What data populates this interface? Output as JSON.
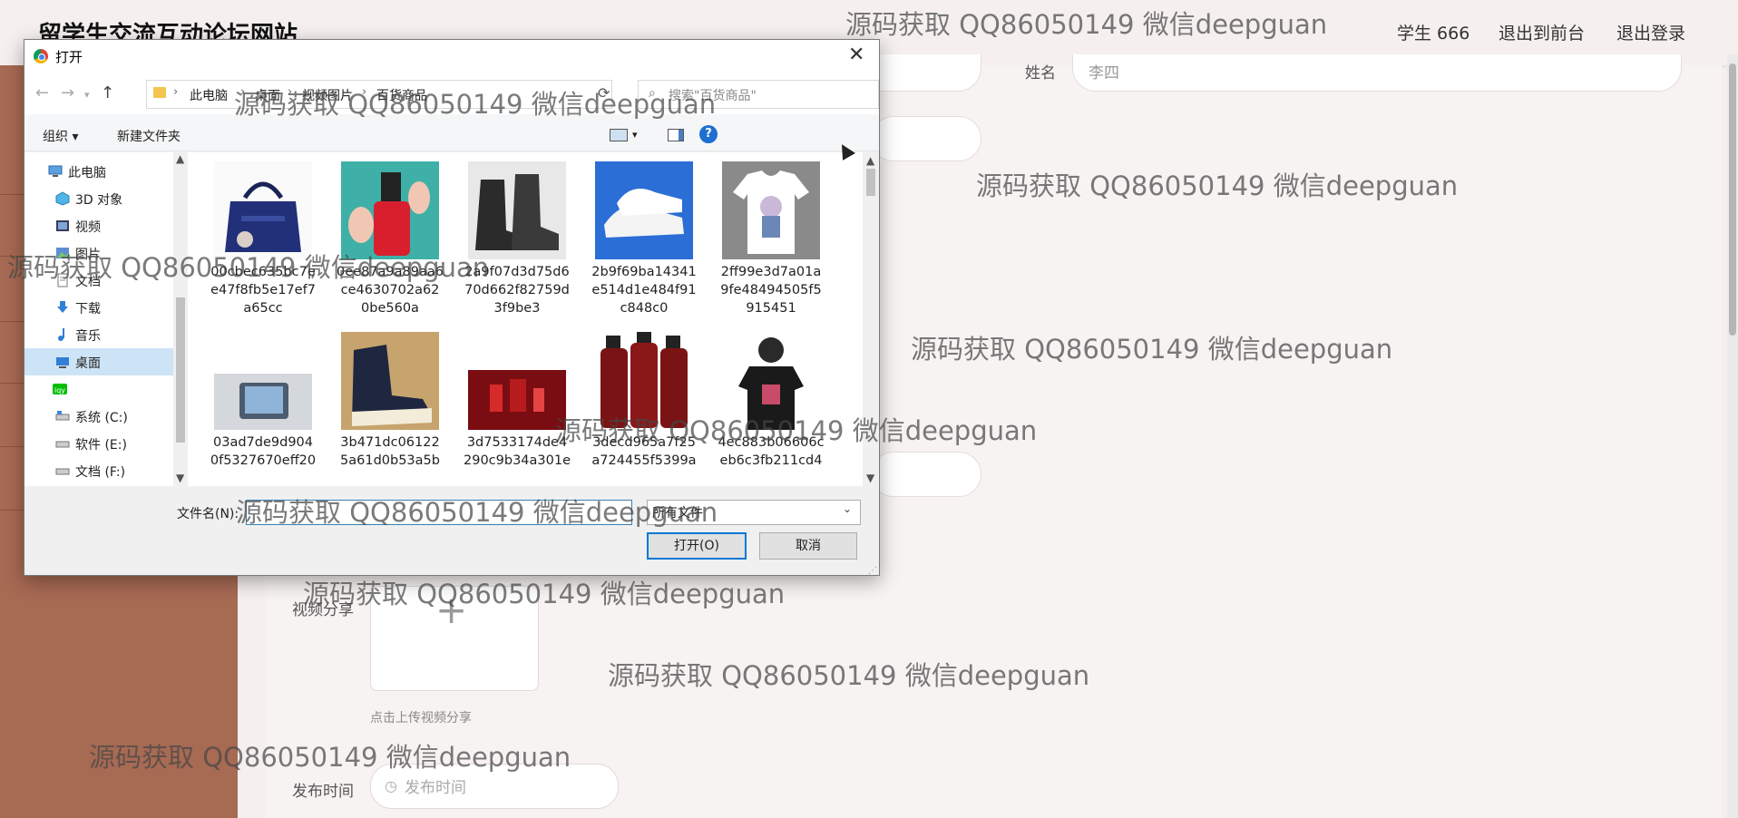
{
  "app": {
    "site_title": "留学生交流互动论坛网站",
    "nav": {
      "user": "学生 666",
      "back_to_front": "退出到前台",
      "logout": "退出登录"
    },
    "form": {
      "name_label": "姓名",
      "name_value": "李四",
      "video_label": "视频分享",
      "upload_plus": "+",
      "upload_hint": "点击上传视频分享",
      "time_label": "发布时间",
      "time_placeholder": "发布时间"
    }
  },
  "dialog": {
    "title": "打开",
    "close": "✕",
    "address": [
      "此电脑",
      "桌面",
      "视频图片",
      "百货商品"
    ],
    "search_placeholder": "搜索\"百货商品\"",
    "toolbar": {
      "organize": "组织 ▾",
      "new_folder": "新建文件夹",
      "help": "?"
    },
    "tree": [
      {
        "label": "此电脑",
        "icon": "computer-icon"
      },
      {
        "label": "3D 对象",
        "icon": "3d-objects-icon"
      },
      {
        "label": "视频",
        "icon": "video-icon"
      },
      {
        "label": "图片",
        "icon": "picture-icon"
      },
      {
        "label": "文档",
        "icon": "document-icon"
      },
      {
        "label": "下载",
        "icon": "download-icon"
      },
      {
        "label": "音乐",
        "icon": "music-icon"
      },
      {
        "label": "桌面",
        "icon": "desktop-icon",
        "selected": true
      },
      {
        "label": "",
        "icon": "iqiyi-icon"
      },
      {
        "label": "系统 (C:)",
        "icon": "drive-icon"
      },
      {
        "label": "软件 (E:)",
        "icon": "drive-icon"
      },
      {
        "label": "文档 (F:)",
        "icon": "drive-icon"
      }
    ],
    "files": [
      {
        "name": "00cbec635bc7ee47f8fb5e17ef7a65cc",
        "icon": "handbag-thumbnail"
      },
      {
        "name": "0ee87a9a89aa6ce4630702a620be560a",
        "icon": "nail-polish-thumbnail"
      },
      {
        "name": "2a9f07d3d75d670d662f82759d3f9be3",
        "icon": "boots-thumbnail"
      },
      {
        "name": "2b9f69ba14341e514d1e484f91c848c0",
        "icon": "sneakers-thumbnail"
      },
      {
        "name": "2ff99e3d7a01a9fe48494505f5915451",
        "icon": "tshirt-thumbnail"
      },
      {
        "name": "03ad7de9d9040f5327670eff20",
        "icon": "phone-thumbnail"
      },
      {
        "name": "3b471dc061225a61d0b53a5b",
        "icon": "high-top-shoes-thumbnail"
      },
      {
        "name": "3d7533174de4290c9b34a301e",
        "icon": "cosmetics-thumbnail"
      },
      {
        "name": "3decd965a7f25a724455f5399a",
        "icon": "shampoo-thumbnail"
      },
      {
        "name": "4ec883b06606ceb6c3fb211cd4",
        "icon": "black-tshirt-thumbnail"
      }
    ],
    "filename_label": "文件名(N):",
    "filename_value": "",
    "filetype": "所有文件",
    "open_button": "打开(O)",
    "cancel_button": "取消"
  },
  "watermark": "源码获取 QQ86050149 微信deepguan",
  "colors": {
    "sidebar": "#a76a53",
    "accent": "#0078d7",
    "selected": "#cde4f7"
  }
}
